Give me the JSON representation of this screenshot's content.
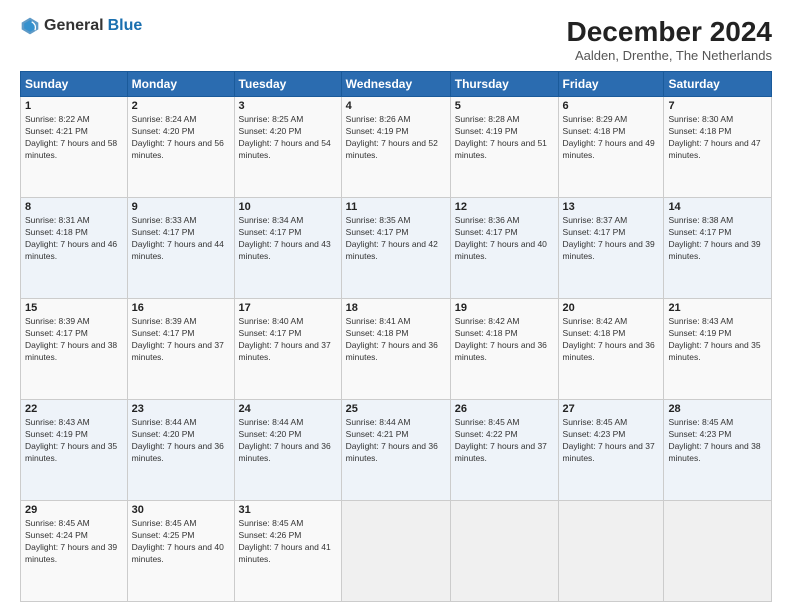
{
  "header": {
    "logo_general": "General",
    "logo_blue": "Blue",
    "month": "December 2024",
    "location": "Aalden, Drenthe, The Netherlands"
  },
  "weekdays": [
    "Sunday",
    "Monday",
    "Tuesday",
    "Wednesday",
    "Thursday",
    "Friday",
    "Saturday"
  ],
  "weeks": [
    [
      {
        "day": "1",
        "sunrise": "8:22 AM",
        "sunset": "4:21 PM",
        "daylight": "7 hours and 58 minutes."
      },
      {
        "day": "2",
        "sunrise": "8:24 AM",
        "sunset": "4:20 PM",
        "daylight": "7 hours and 56 minutes."
      },
      {
        "day": "3",
        "sunrise": "8:25 AM",
        "sunset": "4:20 PM",
        "daylight": "7 hours and 54 minutes."
      },
      {
        "day": "4",
        "sunrise": "8:26 AM",
        "sunset": "4:19 PM",
        "daylight": "7 hours and 52 minutes."
      },
      {
        "day": "5",
        "sunrise": "8:28 AM",
        "sunset": "4:19 PM",
        "daylight": "7 hours and 51 minutes."
      },
      {
        "day": "6",
        "sunrise": "8:29 AM",
        "sunset": "4:18 PM",
        "daylight": "7 hours and 49 minutes."
      },
      {
        "day": "7",
        "sunrise": "8:30 AM",
        "sunset": "4:18 PM",
        "daylight": "7 hours and 47 minutes."
      }
    ],
    [
      {
        "day": "8",
        "sunrise": "8:31 AM",
        "sunset": "4:18 PM",
        "daylight": "7 hours and 46 minutes."
      },
      {
        "day": "9",
        "sunrise": "8:33 AM",
        "sunset": "4:17 PM",
        "daylight": "7 hours and 44 minutes."
      },
      {
        "day": "10",
        "sunrise": "8:34 AM",
        "sunset": "4:17 PM",
        "daylight": "7 hours and 43 minutes."
      },
      {
        "day": "11",
        "sunrise": "8:35 AM",
        "sunset": "4:17 PM",
        "daylight": "7 hours and 42 minutes."
      },
      {
        "day": "12",
        "sunrise": "8:36 AM",
        "sunset": "4:17 PM",
        "daylight": "7 hours and 40 minutes."
      },
      {
        "day": "13",
        "sunrise": "8:37 AM",
        "sunset": "4:17 PM",
        "daylight": "7 hours and 39 minutes."
      },
      {
        "day": "14",
        "sunrise": "8:38 AM",
        "sunset": "4:17 PM",
        "daylight": "7 hours and 39 minutes."
      }
    ],
    [
      {
        "day": "15",
        "sunrise": "8:39 AM",
        "sunset": "4:17 PM",
        "daylight": "7 hours and 38 minutes."
      },
      {
        "day": "16",
        "sunrise": "8:39 AM",
        "sunset": "4:17 PM",
        "daylight": "7 hours and 37 minutes."
      },
      {
        "day": "17",
        "sunrise": "8:40 AM",
        "sunset": "4:17 PM",
        "daylight": "7 hours and 37 minutes."
      },
      {
        "day": "18",
        "sunrise": "8:41 AM",
        "sunset": "4:18 PM",
        "daylight": "7 hours and 36 minutes."
      },
      {
        "day": "19",
        "sunrise": "8:42 AM",
        "sunset": "4:18 PM",
        "daylight": "7 hours and 36 minutes."
      },
      {
        "day": "20",
        "sunrise": "8:42 AM",
        "sunset": "4:18 PM",
        "daylight": "7 hours and 36 minutes."
      },
      {
        "day": "21",
        "sunrise": "8:43 AM",
        "sunset": "4:19 PM",
        "daylight": "7 hours and 35 minutes."
      }
    ],
    [
      {
        "day": "22",
        "sunrise": "8:43 AM",
        "sunset": "4:19 PM",
        "daylight": "7 hours and 35 minutes."
      },
      {
        "day": "23",
        "sunrise": "8:44 AM",
        "sunset": "4:20 PM",
        "daylight": "7 hours and 36 minutes."
      },
      {
        "day": "24",
        "sunrise": "8:44 AM",
        "sunset": "4:20 PM",
        "daylight": "7 hours and 36 minutes."
      },
      {
        "day": "25",
        "sunrise": "8:44 AM",
        "sunset": "4:21 PM",
        "daylight": "7 hours and 36 minutes."
      },
      {
        "day": "26",
        "sunrise": "8:45 AM",
        "sunset": "4:22 PM",
        "daylight": "7 hours and 37 minutes."
      },
      {
        "day": "27",
        "sunrise": "8:45 AM",
        "sunset": "4:23 PM",
        "daylight": "7 hours and 37 minutes."
      },
      {
        "day": "28",
        "sunrise": "8:45 AM",
        "sunset": "4:23 PM",
        "daylight": "7 hours and 38 minutes."
      }
    ],
    [
      {
        "day": "29",
        "sunrise": "8:45 AM",
        "sunset": "4:24 PM",
        "daylight": "7 hours and 39 minutes."
      },
      {
        "day": "30",
        "sunrise": "8:45 AM",
        "sunset": "4:25 PM",
        "daylight": "7 hours and 40 minutes."
      },
      {
        "day": "31",
        "sunrise": "8:45 AM",
        "sunset": "4:26 PM",
        "daylight": "7 hours and 41 minutes."
      },
      null,
      null,
      null,
      null
    ]
  ]
}
